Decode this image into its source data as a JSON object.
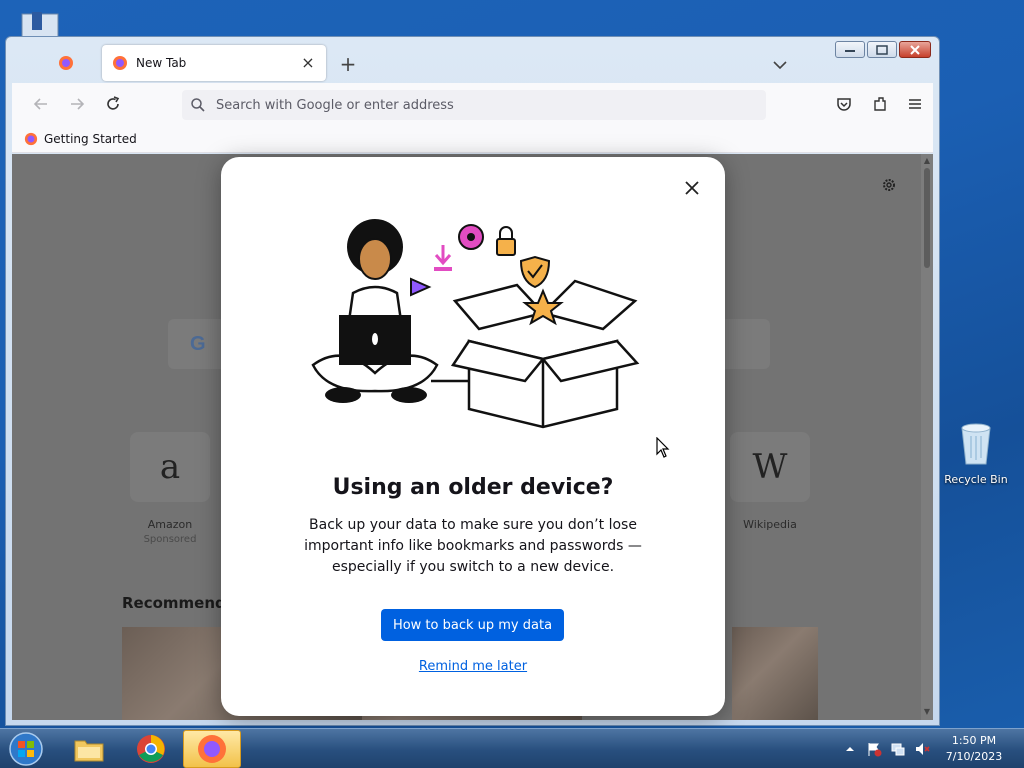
{
  "desktop": {
    "recycle_bin_label": "Recycle Bin"
  },
  "browser": {
    "tab_title": "New Tab",
    "new_tab_symbol": "+",
    "close_tab_symbol": "×",
    "url_placeholder": "Search with Google or enter address",
    "bookmark_label": "Getting Started",
    "icons": [
      "firefox-icon",
      "back-icon",
      "forward-icon",
      "reload-icon",
      "search-icon",
      "pocket-icon",
      "extensions-icon",
      "menu-icon",
      "tab-list-icon"
    ]
  },
  "newtab_page": {
    "google_letter": "G",
    "tiles": [
      {
        "name": "Amazon",
        "sponsored": "Sponsored",
        "glyph": "a"
      },
      {
        "name": "Wikipedia",
        "sponsored": "",
        "glyph": "W"
      }
    ],
    "recommended_heading": "Recommende"
  },
  "modal": {
    "title": "Using an older device?",
    "body": "Back up your data to make sure you don’t lose important info like bookmarks and passwords — especially if you switch to a new device.",
    "primary_button": "How to back up my data",
    "secondary_link": "Remind me later"
  },
  "taskbar": {
    "items": [
      "start-button",
      "file-explorer",
      "chrome",
      "firefox"
    ],
    "clock_time": "1:50 PM",
    "clock_date": "7/10/2023"
  },
  "colors": {
    "accent": "#0061e0",
    "desktop": "#1d63b8",
    "overlay": "#737373"
  }
}
